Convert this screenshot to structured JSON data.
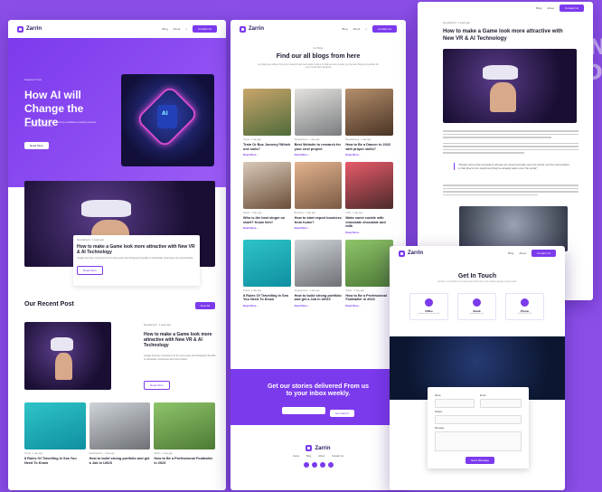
{
  "brand": {
    "logo_text": "Zarrin",
    "accent": "#7c3aed",
    "bg": "#8b4fe8"
  },
  "background_text": [
    "ON",
    "ED"
  ],
  "nav": {
    "links": [
      "Blog",
      "About"
    ],
    "cta": "Contact Us"
  },
  "home": {
    "hero": {
      "eyebrow": "Featured Post",
      "title": "How AI will Change the Future",
      "desc": "The future of AI is full of many exciting possibilities including machine learning and deep learning.",
      "button": "Read More"
    },
    "featured": {
      "meta": "Development · 1 week ago",
      "title": "How to make a Game look more attractive with New VR & AI Technology",
      "desc": "Google has been investing in AI for many years and bringing its benefits to individuals, businesses and communities.",
      "button": "Read More"
    },
    "recent_heading": "Our Recent Post",
    "recent_button": "View All",
    "recent": {
      "meta": "Development · 1 week ago",
      "title": "How to make a Game look more attractive with New VR & AI Technology",
      "desc": "Google has been investing in AI for many years and bringing its benefits to individuals, businesses and communities.",
      "button": "Read More"
    },
    "cards": [
      {
        "meta": "Travel · 1 day ago",
        "title": "8 Rules Of Travelling In Sea You Need To Know"
      },
      {
        "meta": "Development · 1 day ago",
        "title": "How to build strong portfolio and get a Job in UI/UX"
      },
      {
        "meta": "Sports · 1 day ago",
        "title": "How to Be a Professional Footballer in 2023"
      }
    ]
  },
  "blog": {
    "eyebrow": "Our Blogs",
    "heading": "Find our all blogs from here",
    "sub": "our blogs are written from very research and well known writers so that we can provide you the best blogs and articles for you to read them all along",
    "posts": [
      {
        "meta": "Travel · 1 day ago",
        "title": "Train Or Bus Journey?Which one suits?",
        "more": "Read More..."
      },
      {
        "meta": "Development · 1 day ago",
        "title": "Best Website to research for your next project",
        "more": "Read More..."
      },
      {
        "meta": "Development · 1 day ago",
        "title": "How to Be a Dancer in 2023 with proper skills?",
        "more": "Read More..."
      },
      {
        "meta": "Sports · 1 day ago",
        "title": "Who is the best singer on chart? Know him?",
        "more": "Read More..."
      },
      {
        "meta": "Business · 1 day ago",
        "title": "How to start export business from home?",
        "more": "Read More..."
      },
      {
        "meta": "Food · 1 day ago",
        "title": "Make some cookie with chocolate chocolate and milk",
        "more": "Read More..."
      },
      {
        "meta": "Travel · 1 day ago",
        "title": "8 Rules Of Travelling In Sea You Need To Know",
        "more": "Read More..."
      },
      {
        "meta": "Development · 1 day ago",
        "title": "How to build strong portfolio and get a Job in UI/UX",
        "more": "Read More..."
      },
      {
        "meta": "Sports · 1 day ago",
        "title": "How to Be a Professional Footballer in 2023",
        "more": "Read More..."
      }
    ],
    "newsletter": {
      "title": "Get our stories delivered From us to your inbox weekly.",
      "button": "Get started"
    },
    "footer_links": [
      "Home",
      "Blog",
      "About",
      "Contact Us"
    ]
  },
  "article": {
    "meta": "Development · 1 week ago",
    "title": "How to make a Game look more attractive with New VR & AI Technology",
    "quote": "\"People worry that computers will get too smart and take over the world, but the real problem is that they're too stupid and they've already taken over the world.\""
  },
  "contact": {
    "heading": "Get In Touch",
    "sub": "Contact us to publish your content and show ads to our website and get a good reach.",
    "boxes": [
      {
        "title": "Office",
        "text": "Victoria Street, London, UK"
      },
      {
        "title": "Email",
        "text": "hello@gmail.com"
      },
      {
        "title": "Phone",
        "text": "(001) 8520-1345"
      }
    ],
    "form": {
      "name": "Name",
      "email": "Email",
      "subject": "Subject",
      "message": "Message",
      "button": "Send Message"
    }
  }
}
